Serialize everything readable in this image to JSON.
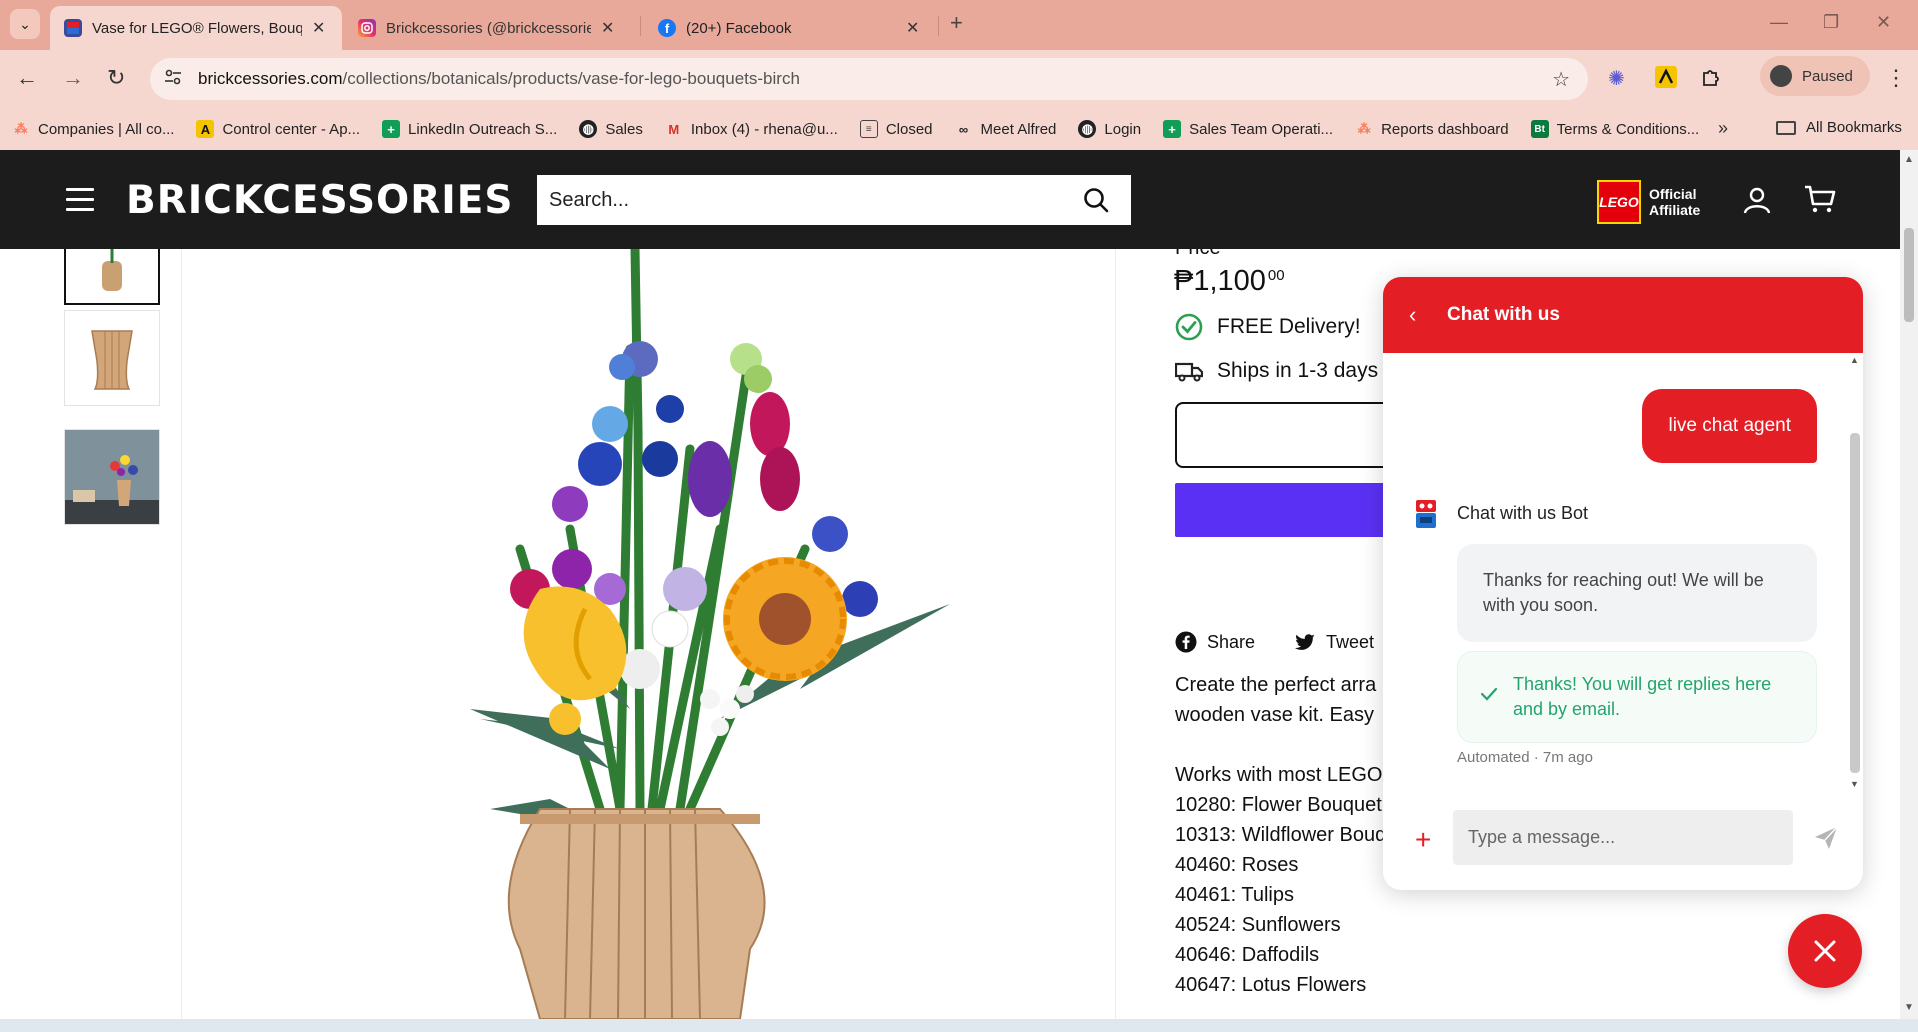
{
  "browser": {
    "tabs": [
      {
        "title": "Vase for LEGO® Flowers, Bouquets",
        "active": true
      },
      {
        "title": "Brickcessories (@brickcessories)",
        "active": false
      },
      {
        "title": "(20+) Facebook",
        "active": false
      }
    ],
    "url_host": "brickcessories.com",
    "url_path": "/collections/botanicals/products/vase-for-lego-bouquets-birch",
    "profile_status": "Paused",
    "bookmarks": [
      {
        "label": "Companies | All co...",
        "icon": "hubspot-icon",
        "color": "#ff7a59"
      },
      {
        "label": "Control center - Ap...",
        "icon": "apollo-icon",
        "color": "#f5c400"
      },
      {
        "label": "LinkedIn Outreach S...",
        "icon": "sheets-icon",
        "color": "#0f9d58"
      },
      {
        "label": "Sales",
        "icon": "globe-icon",
        "color": "#222222"
      },
      {
        "label": "Inbox (4) - rhena@u...",
        "icon": "gmail-icon",
        "color": "#d93025"
      },
      {
        "label": "Closed",
        "icon": "doc-icon",
        "color": "#444444"
      },
      {
        "label": "Meet Alfred",
        "icon": "alfred-icon",
        "color": "#222222"
      },
      {
        "label": "Login",
        "icon": "globe-icon",
        "color": "#222222"
      },
      {
        "label": "Sales Team Operati...",
        "icon": "sheets-icon",
        "color": "#0f9d58"
      },
      {
        "label": "Reports dashboard",
        "icon": "hubspot-icon",
        "color": "#ff7a59"
      },
      {
        "label": "Terms & Conditions...",
        "icon": "bonsai-icon",
        "color": "#0b7a3e"
      }
    ],
    "all_bookmarks": "All Bookmarks"
  },
  "site": {
    "brand": "BRICKCESSORIES",
    "search_placeholder": "Search...",
    "lego_logo": "LEGO",
    "affiliate_line1": "Official",
    "affiliate_line2": "Affiliate"
  },
  "product": {
    "price_label_partial": "Price",
    "price_main": "₱1,100",
    "price_cents": "00",
    "free_delivery": "FREE Delivery!",
    "ships": "Ships in 1-3 days",
    "share": "Share",
    "tweet": "Tweet",
    "desc_line1": "Create the perfect arra",
    "desc_line2": "wooden vase kit.  Easy",
    "works_with": "Works with most LEGO",
    "sets": [
      "10280: Flower Bouquet",
      "10313: Wildflower Bouq",
      "40460: Roses",
      "40461: Tulips",
      "40524: Sunflowers",
      "40646: Daffodils",
      "40647: Lotus Flowers"
    ]
  },
  "chat": {
    "header_title": "Chat with us",
    "user_message": "live chat agent",
    "bot_name": "Chat with us Bot",
    "bot_message": "Thanks for reaching out! We will be with you soon.",
    "notice": "Thanks! You will get replies here and by email.",
    "meta": "Automated · 7m ago",
    "input_placeholder": "Type a message..."
  },
  "colors": {
    "accent_red": "#e31e24",
    "buy_purple": "#5a31f4",
    "header_dark": "#1c1c1c",
    "success_green": "#24a46d"
  }
}
